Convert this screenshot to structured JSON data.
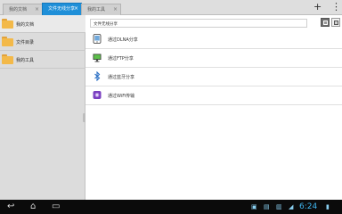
{
  "tabs": [
    {
      "label": "我的文档",
      "active": false
    },
    {
      "label": "文件无线分享",
      "active": true
    },
    {
      "label": "我的工具",
      "active": false
    }
  ],
  "toolbar": {
    "add_glyph": "+",
    "menu_glyph": "⋮"
  },
  "sidebar": {
    "items": [
      {
        "label": "我的文档",
        "icon": "folder-icon",
        "selected": true
      },
      {
        "label": "文件目录",
        "icon": "folder-icon",
        "selected": false
      },
      {
        "label": "我的工具",
        "icon": "folder-icon",
        "selected": false
      }
    ]
  },
  "main": {
    "path": "文件无线分享",
    "view_modes": [
      "grid-view",
      "list-view"
    ],
    "rows": [
      {
        "label": "通过DLNA分享",
        "icon": "dlna-icon"
      },
      {
        "label": "通过FTP分享",
        "icon": "ftp-monitor-icon"
      },
      {
        "label": "通过蓝牙分享",
        "icon": "bluetooth-icon"
      },
      {
        "label": "通过WiFi传输",
        "icon": "wifi-transfer-icon"
      }
    ]
  },
  "navbar": {
    "back_glyph": "↩",
    "home_glyph": "⌂",
    "recent_glyph": "▭",
    "clock": "6:24",
    "accent": "#3fb6f0"
  }
}
